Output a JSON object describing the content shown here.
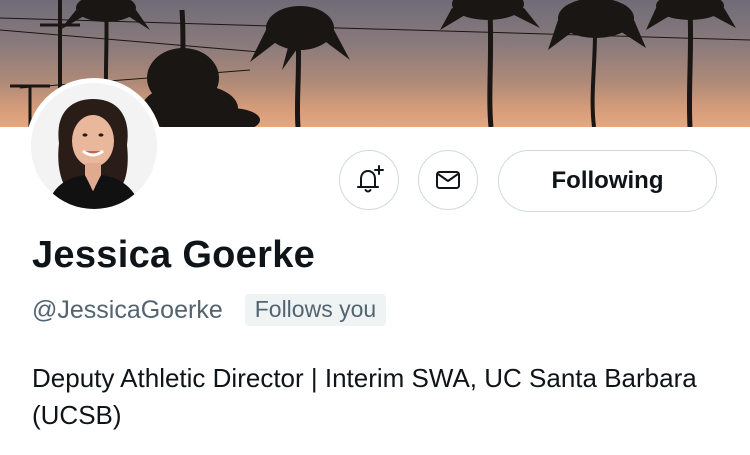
{
  "profile": {
    "name": "Jessica Goerke",
    "handle": "@JessicaGoerke",
    "follows_you_badge": "Follows you",
    "bio": "Deputy Athletic Director | Interim SWA, UC Santa Barbara (UCSB)"
  },
  "actions": {
    "notify_icon": "bell-plus-icon",
    "message_icon": "envelope-icon",
    "follow_label": "Following"
  },
  "colors": {
    "text_primary": "#0f1419",
    "text_secondary": "#536471",
    "button_border": "#cfd9de",
    "badge_bg": "#eff3f4"
  }
}
